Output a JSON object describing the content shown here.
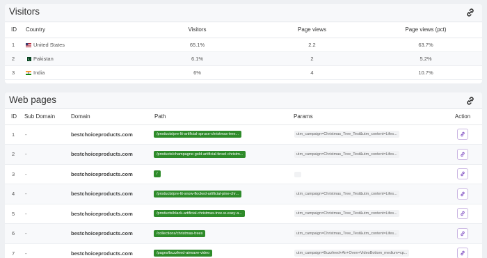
{
  "visitors": {
    "title": "Visitors",
    "headers": {
      "id": "ID",
      "country": "Country",
      "visitors": "Visitors",
      "page_views": "Page views",
      "page_views_pct": "Page views (pct)"
    },
    "rows": [
      {
        "id": "1",
        "country": "United States",
        "flag": "us",
        "visitors": "65.1%",
        "page_views": "2.2",
        "page_views_pct": "63.7%"
      },
      {
        "id": "2",
        "country": "Pakistan",
        "flag": "pk",
        "visitors": "6.1%",
        "page_views": "2",
        "page_views_pct": "5.2%"
      },
      {
        "id": "3",
        "country": "India",
        "flag": "in",
        "visitors": "6%",
        "page_views": "4",
        "page_views_pct": "10.7%"
      }
    ]
  },
  "webpages": {
    "title": "Web pages",
    "headers": {
      "id": "ID",
      "subdomain": "Sub Domain",
      "domain": "Domain",
      "path": "Path",
      "params": "Params",
      "action": "Action"
    },
    "rows": [
      {
        "id": "1",
        "subdomain": "-",
        "domain": "bestchoiceproducts.com",
        "path": "/products/pre-lit-artificial-spruce-christmas-tree...",
        "params": "utm_campaign=Christmas_Tree_Test&utm_content=Lifes..."
      },
      {
        "id": "2",
        "subdomain": "-",
        "domain": "bestchoiceproducts.com",
        "path": "/products/champagne-gold-artificial-tinsel-christm...",
        "params": "utm_campaign=Christmas_Tree_Test&utm_content=Lifes..."
      },
      {
        "id": "3",
        "subdomain": "-",
        "domain": "bestchoiceproducts.com",
        "path": "/",
        "params": ""
      },
      {
        "id": "4",
        "subdomain": "-",
        "domain": "bestchoiceproducts.com",
        "path": "/products/pre-lit-snow-flocked-artificial-pine-chr...",
        "params": "utm_campaign=Christmas_Tree_Test&utm_content=Lifes..."
      },
      {
        "id": "5",
        "subdomain": "-",
        "domain": "bestchoiceproducts.com",
        "path": "/products/black-artificial-christmas-tree-w-easy-a...",
        "params": "utm_campaign=Christmas_Tree_Test&utm_content=Lifes..."
      },
      {
        "id": "6",
        "subdomain": "-",
        "domain": "bestchoiceproducts.com",
        "path": "/collections/christmas-trees",
        "params": "utm_campaign=Christmas_Tree_Test&utm_content=Lifes..."
      },
      {
        "id": "7",
        "subdomain": "-",
        "domain": "bestchoiceproducts.com",
        "path": "/pages/buzzfeed-airwave-video",
        "params": "utm_campaign=Buzzfeed+Air+Oven+VideoBottom_medium=cp..."
      }
    ]
  },
  "icons": {
    "link": "link-icon",
    "action": "link-icon"
  },
  "colors": {
    "path_badge": "#2e8b2a",
    "action_border": "#cbb7e3",
    "action_icon": "#8a5cc7"
  }
}
